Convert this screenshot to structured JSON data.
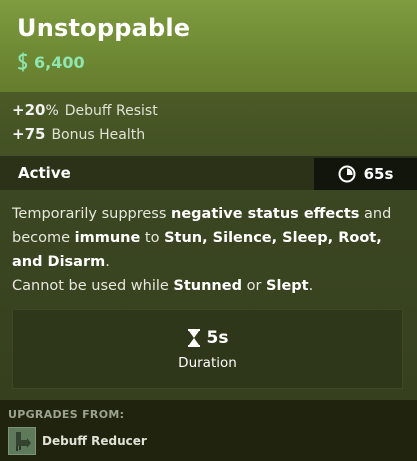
{
  "item": {
    "title": "Unstoppable",
    "cost": "6,400",
    "cost_icon": "souls-currency-icon"
  },
  "stats": [
    {
      "value": "+20",
      "unit": "%",
      "label": "Debuff Resist"
    },
    {
      "value": "+75",
      "unit": "",
      "label": "Bonus Health"
    }
  ],
  "active": {
    "label": "Active",
    "cooldown": "65s",
    "cooldown_icon": "cooldown-clock-icon"
  },
  "description": {
    "p1": "Temporarily suppress ",
    "h1": "negative status effects",
    "p2": " and become ",
    "h2": "immune",
    "p3": " to ",
    "h3": "Stun, Silence, Sleep, Root, and Disarm",
    "p4": ".",
    "p5": "Cannot be used while ",
    "h4": "Stunned",
    "p6": " or ",
    "h5": "Slept",
    "p7": "."
  },
  "duration": {
    "value": "5s",
    "label": "Duration",
    "icon": "hourglass-icon"
  },
  "upgrades": {
    "title": "UPGRADES FROM:",
    "items": [
      {
        "name": "Debuff Reducer",
        "icon": "debuff-reducer-icon"
      }
    ]
  },
  "colors": {
    "header": "#7f9c40",
    "cost": "#8fe6b0",
    "body": "#3b4622",
    "active_bar": "#2b3217",
    "cooldown_bg": "#12150b"
  }
}
